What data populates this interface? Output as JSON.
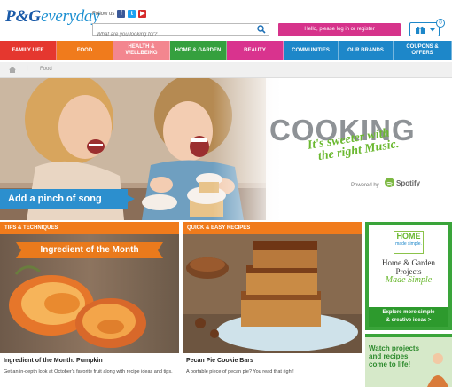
{
  "header": {
    "logo_primary": "P&G",
    "logo_secondary": "everyday",
    "follow_label": "Follow us",
    "social": [
      {
        "name": "facebook-icon",
        "glyph": "f",
        "color": "#3b5998"
      },
      {
        "name": "twitter-icon",
        "glyph": "t",
        "color": "#1da1f2"
      },
      {
        "name": "youtube-icon",
        "glyph": "▶",
        "color": "#d62b2b"
      }
    ],
    "search_placeholder": "What are you looking for?",
    "login_label": "Hello, please log in or register",
    "cart_count": "0"
  },
  "nav": [
    {
      "label": "FAMILY LIFE",
      "color": "#e5372f",
      "w": 64
    },
    {
      "label": "FOOD",
      "color": "#f07b1c",
      "w": 64
    },
    {
      "label": "HEALTH &\nWELLBEING",
      "color": "#f3868f",
      "w": 64
    },
    {
      "label": "HOME & GARDEN",
      "color": "#35a03e",
      "w": 64
    },
    {
      "label": "BEAUTY",
      "color": "#d9338e",
      "w": 64
    },
    {
      "label": "COMMUNITIES",
      "color": "#1d87c9",
      "w": 62
    },
    {
      "label": "OUR BRANDS",
      "color": "#1d87c9",
      "w": 62
    },
    {
      "label": "COUPONS &\nOFFERS",
      "color": "#1d87c9",
      "w": 66
    }
  ],
  "breadcrumb": {
    "current": "Food"
  },
  "hero": {
    "title": "COOKING",
    "tagline_line1": "It's sweeter with",
    "tagline_line2": "the right Music.",
    "powered_label": "Powered by",
    "spotify_label": "Spotify",
    "cta": "Add a pinch of song"
  },
  "cards": [
    {
      "category": "TIPS & TECHNIQUES",
      "category_color": "#f07b1c",
      "banner": "Ingredient of the Month",
      "title": "Ingredient of the Month: Pumpkin",
      "description": "Get an in-depth look at October's favorite fruit along with recipe ideas and tips."
    },
    {
      "category": "QUICK & EASY RECIPES",
      "category_color": "#f07b1c",
      "title": "Pecan Pie Cookie Bars",
      "description": "A portable piece of pecan pie? You read that right!"
    }
  ],
  "side_promos": {
    "home_logo_line1": "HOME",
    "home_logo_line2": "made simple.",
    "promo_title_line1": "Home & Garden",
    "promo_title_line2": "Projects",
    "promo_script": "Made Simple",
    "promo_cta_line1": "Explore more simple",
    "promo_cta_line2": "& creative ideas >",
    "watch_line1": "Watch projects",
    "watch_line2": "and recipes",
    "watch_line3": "come to life!"
  }
}
